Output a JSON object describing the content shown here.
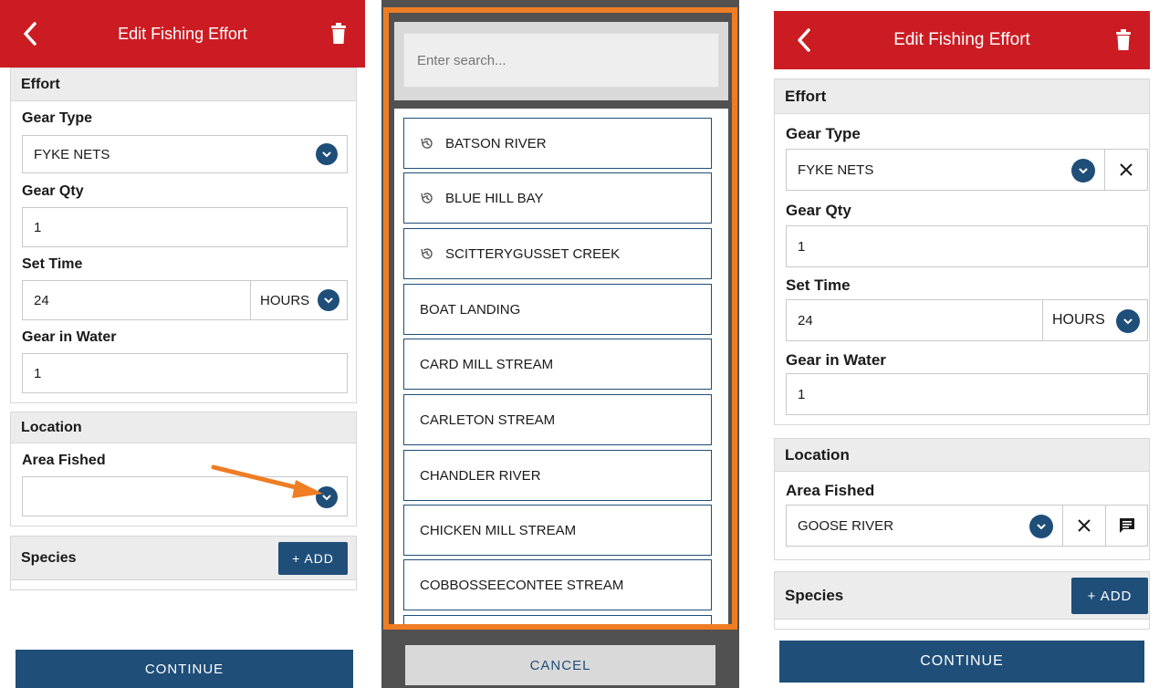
{
  "left": {
    "header": {
      "title": "Edit Fishing Effort",
      "back_icon": "chevron-left-icon",
      "delete_icon": "trash-icon"
    },
    "effort": {
      "heading": "Effort",
      "gear_type": {
        "label": "Gear Type",
        "value": "FYKE NETS"
      },
      "gear_qty": {
        "label": "Gear Qty",
        "value": "1"
      },
      "set_time": {
        "label": "Set Time",
        "value": "24",
        "unit": "HOURS"
      },
      "gear_in_water": {
        "label": "Gear in Water",
        "value": "1"
      }
    },
    "location": {
      "heading": "Location",
      "area_fished": {
        "label": "Area Fished",
        "value": ""
      }
    },
    "species": {
      "heading": "Species",
      "add_label": "+ ADD"
    },
    "continue_label": "CONTINUE"
  },
  "middle": {
    "search": {
      "placeholder": "Enter search..."
    },
    "items": [
      {
        "label": "BATSON RIVER",
        "recent": true
      },
      {
        "label": "BLUE HILL BAY",
        "recent": true
      },
      {
        "label": "SCITTERYGUSSET CREEK",
        "recent": true
      },
      {
        "label": "BOAT LANDING",
        "recent": false
      },
      {
        "label": "CARD MILL STREAM",
        "recent": false
      },
      {
        "label": "CARLETON STREAM",
        "recent": false
      },
      {
        "label": "CHANDLER RIVER",
        "recent": false
      },
      {
        "label": "CHICKEN MILL STREAM",
        "recent": false
      },
      {
        "label": "COBBOSSEECONTEE STREAM",
        "recent": false
      }
    ],
    "cancel_label": "CANCEL"
  },
  "right": {
    "header": {
      "title": "Edit Fishing Effort",
      "back_icon": "chevron-left-icon",
      "delete_icon": "trash-icon"
    },
    "effort": {
      "heading": "Effort",
      "gear_type": {
        "label": "Gear Type",
        "value": "FYKE NETS"
      },
      "gear_qty": {
        "label": "Gear Qty",
        "value": "1"
      },
      "set_time": {
        "label": "Set Time",
        "value": "24",
        "unit": "HOURS"
      },
      "gear_in_water": {
        "label": "Gear in Water",
        "value": "1"
      }
    },
    "location": {
      "heading": "Location",
      "area_fished": {
        "label": "Area Fished",
        "value": "GOOSE RIVER"
      }
    },
    "species": {
      "heading": "Species",
      "add_label": "+ ADD"
    },
    "continue_label": "CONTINUE"
  },
  "colors": {
    "header_red": "#cc1c23",
    "primary_blue": "#1f4e79",
    "highlight_orange": "#ef7d24",
    "section_gray": "#ececec"
  }
}
